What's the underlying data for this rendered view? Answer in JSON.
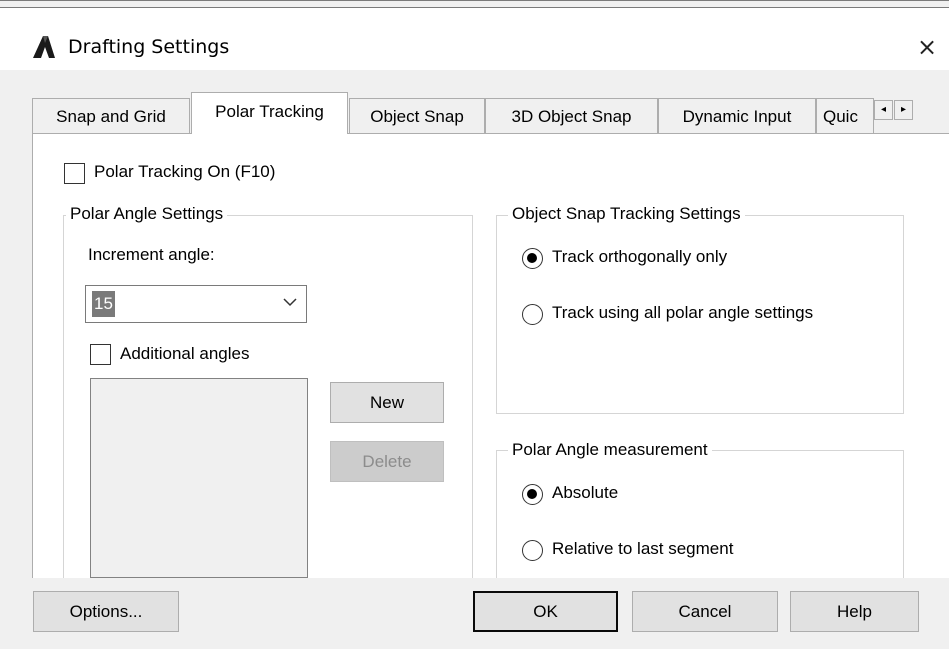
{
  "window": {
    "title": "Drafting Settings",
    "close_glyph": "×",
    "app_icon": "autocad-a-icon"
  },
  "tabs": [
    {
      "label": "Snap and Grid",
      "active": false
    },
    {
      "label": "Polar Tracking",
      "active": true
    },
    {
      "label": "Object Snap",
      "active": false
    },
    {
      "label": "3D Object Snap",
      "active": false
    },
    {
      "label": "Dynamic Input",
      "active": false
    },
    {
      "label": "Quic",
      "active": false
    }
  ],
  "tab_scroll": {
    "left": "◂",
    "right": "▸"
  },
  "polar_tracking_on": {
    "label": "Polar Tracking On (F10)",
    "checked": false
  },
  "polar_angle_settings": {
    "title": "Polar Angle Settings",
    "increment_label": "Increment angle:",
    "increment_value": "15",
    "additional_angles": {
      "label": "Additional angles",
      "checked": false
    },
    "new_button": "New",
    "delete_button": "Delete"
  },
  "object_snap_tracking": {
    "title": "Object Snap Tracking Settings",
    "options": [
      {
        "label": "Track orthogonally only",
        "selected": true
      },
      {
        "label": "Track using all polar angle settings",
        "selected": false
      }
    ]
  },
  "polar_angle_measurement": {
    "title": "Polar Angle measurement",
    "options": [
      {
        "label": "Absolute",
        "selected": true
      },
      {
        "label": "Relative to last segment",
        "selected": false
      }
    ]
  },
  "footer": {
    "options_button": "Options...",
    "ok_button": "OK",
    "cancel_button": "Cancel",
    "help_button": "Help"
  }
}
